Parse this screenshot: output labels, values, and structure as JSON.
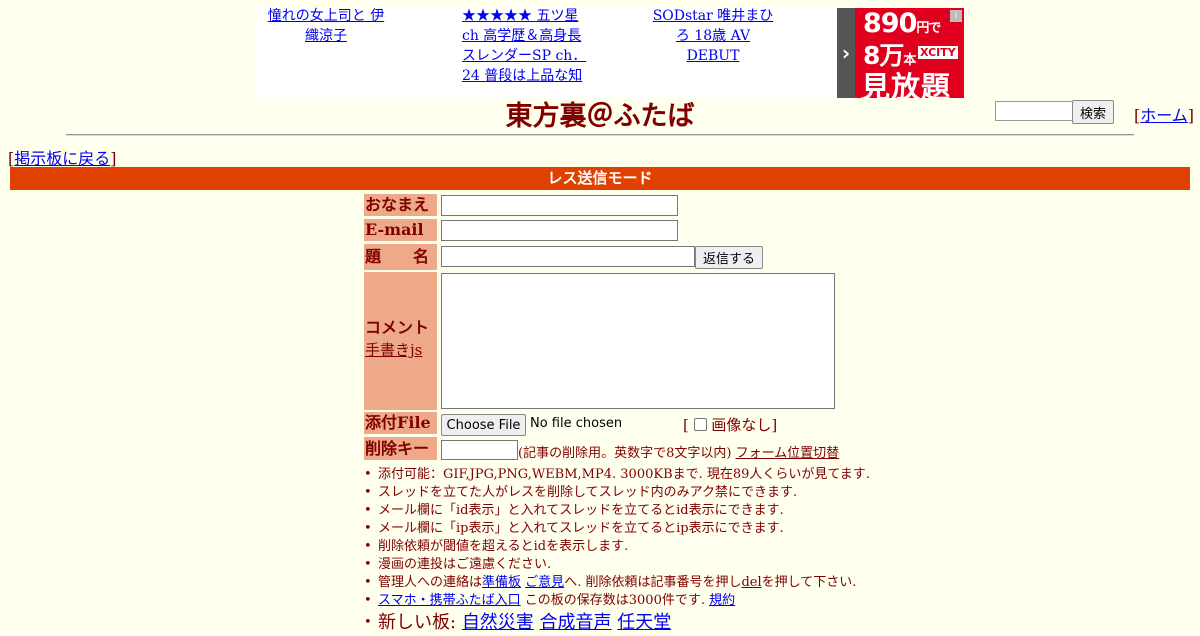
{
  "ad": {
    "items": [
      {
        "line1": "憧れの女上司と 伊",
        "line2": "織涼子"
      },
      {
        "line1": "★★★★★ 五ツ星",
        "line2": "ch 高学歴＆高身長",
        "line3": "スレンダーSP ch．",
        "line4": "24 普段は上品な知"
      },
      {
        "line1": "SODstar 唯井まひ",
        "line2": "ろ 18歳 AV DEBUT"
      }
    ],
    "arrow": "›",
    "promo": {
      "price": "890",
      "price_unit": "円で",
      "count": "8万",
      "count_unit": "本",
      "brand": "XCITY",
      "tagline": "見放題"
    }
  },
  "header": {
    "title": "東方裏＠ふたば",
    "search_button": "検索",
    "home_link": "ホーム",
    "back_link": "掲示板に戻る"
  },
  "mode_bar": "レス送信モード",
  "form": {
    "name_label": "おなまえ",
    "email_label": "E-mail",
    "subject_label": "題　　名",
    "submit_button": "返信する",
    "comment_label": "コメント",
    "handwriting_link": "手書きjs",
    "file_label": "添付File",
    "file_button": "Choose File",
    "file_status": "No file chosen",
    "no_image_label": "画像なし",
    "delete_key_label": "削除キー",
    "delete_key_hint": "(記事の削除用。英数字で8文字以内)",
    "form_position_link": "フォーム位置切替"
  },
  "notes": {
    "n1": "添付可能：GIF,JPG,PNG,WEBM,MP4. 3000KBまで. 現在89人くらいが見てます.",
    "n2": "スレッドを立てた人がレスを削除してスレッド内のみアク禁にできます.",
    "n3": "メール欄に「id表示」と入れてスレッドを立てるとid表示にできます.",
    "n4": "メール欄に「ip表示」と入れてスレッドを立てるとip表示にできます.",
    "n5": "削除依頼が閾値を超えるとidを表示します.",
    "n6": "漫画の連投はご遠慮ください.",
    "n7_prefix": "管理人への連絡は",
    "n7_link1": "準備板",
    "n7_link2": "ご意見",
    "n7_mid": "へ. 削除依頼は記事番号を押し",
    "n7_link3": "del",
    "n7_suffix": "を押して下さい.",
    "n8_link": "スマホ・携帯ふたば入口",
    "n8_text": " この板の保存数は3000件です.",
    "n8_link2": "規約",
    "n9_prefix": "新しい板:",
    "new_boards": [
      "自然災害",
      "合成音声",
      "任天堂"
    ]
  }
}
